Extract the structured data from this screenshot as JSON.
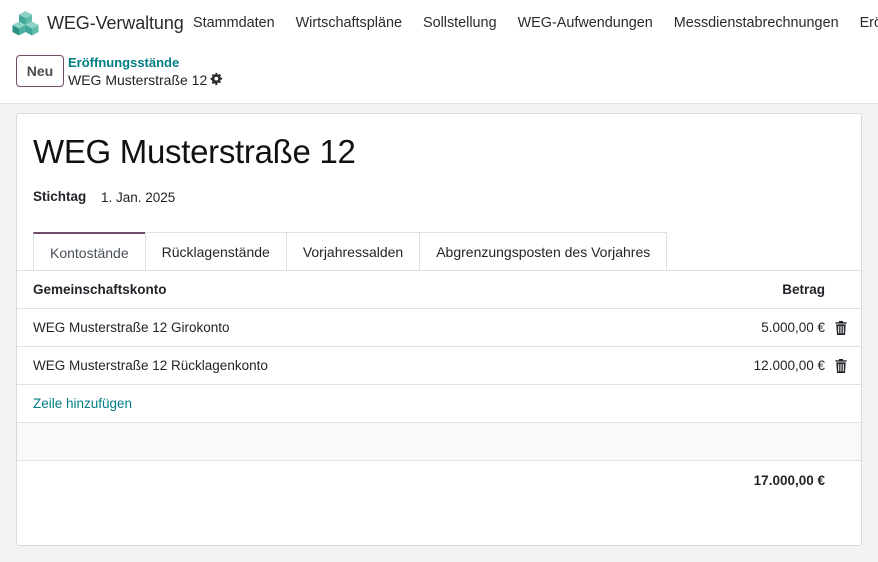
{
  "app": {
    "name": "WEG-Verwaltung",
    "menu": [
      "Stammdaten",
      "Wirtschaftspläne",
      "Sollstellung",
      "WEG-Aufwendungen",
      "Messdienstabrechnungen",
      "Eröffn"
    ]
  },
  "control": {
    "new_label": "Neu",
    "breadcrumb_parent": "Eröffnungsstände",
    "breadcrumb_current": "WEG Musterstraße 12"
  },
  "record": {
    "title": "WEG Musterstraße 12",
    "stichtag_label": "Stichtag",
    "stichtag_value": "1. Jan. 2025"
  },
  "tabs": [
    "Kontostände",
    "Rücklagenstände",
    "Vorjahressalden",
    "Abgrenzungsposten des Vorjahres"
  ],
  "table": {
    "headers": {
      "account": "Gemeinschaftskonto",
      "amount": "Betrag"
    },
    "rows": [
      {
        "account": "WEG Musterstraße 12 Girokonto",
        "amount": "5.000,00 €"
      },
      {
        "account": "WEG Musterstraße 12 Rücklagenkonto",
        "amount": "12.000,00 €"
      }
    ],
    "add_line": "Zeile hinzufügen",
    "total": "17.000,00 €"
  },
  "colors": {
    "brand": "#714b67",
    "link": "#017e84"
  }
}
